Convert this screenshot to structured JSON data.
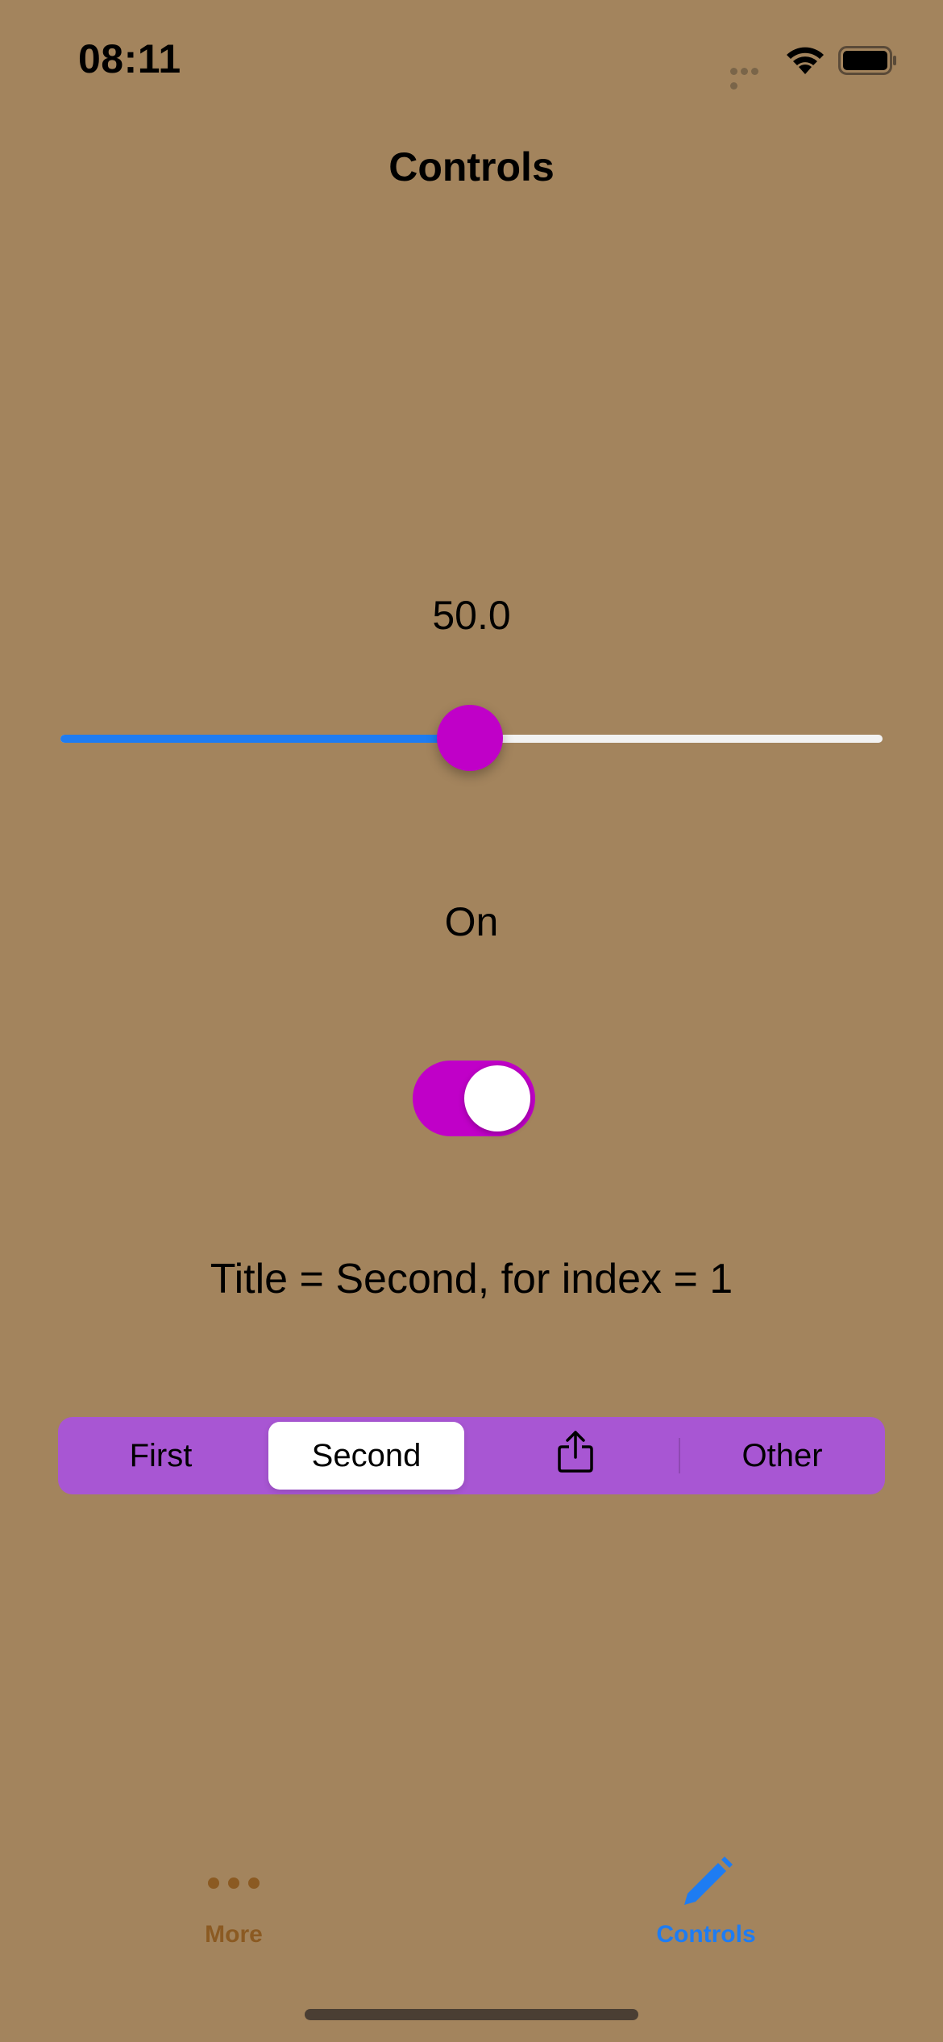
{
  "status_bar": {
    "time": "08:11",
    "icons": [
      "cellular-signal-icon",
      "wifi-icon",
      "battery-icon"
    ]
  },
  "nav": {
    "title": "Controls"
  },
  "slider": {
    "value_text": "50.0",
    "value": 50.0,
    "min": 0,
    "max": 100,
    "fill_color": "#1e7cf2",
    "thumb_color": "#c000c8"
  },
  "toggle": {
    "label": "On",
    "is_on": true,
    "color": "#c000c8"
  },
  "segment_info": "Title = Second, for index = 1",
  "segmented_control": {
    "background_color": "#a856d3",
    "selected_index": 1,
    "segments": [
      {
        "label": "First"
      },
      {
        "label": "Second"
      },
      {
        "icon": "share-icon"
      },
      {
        "label": "Other"
      }
    ]
  },
  "tab_bar": {
    "items": [
      {
        "label": "More",
        "icon": "ellipsis-icon",
        "selected": false
      },
      {
        "label": "Controls",
        "icon": "pencil-icon",
        "selected": true
      }
    ]
  },
  "colors": {
    "background": "#a3845d",
    "accent": "#1e7cf2"
  }
}
